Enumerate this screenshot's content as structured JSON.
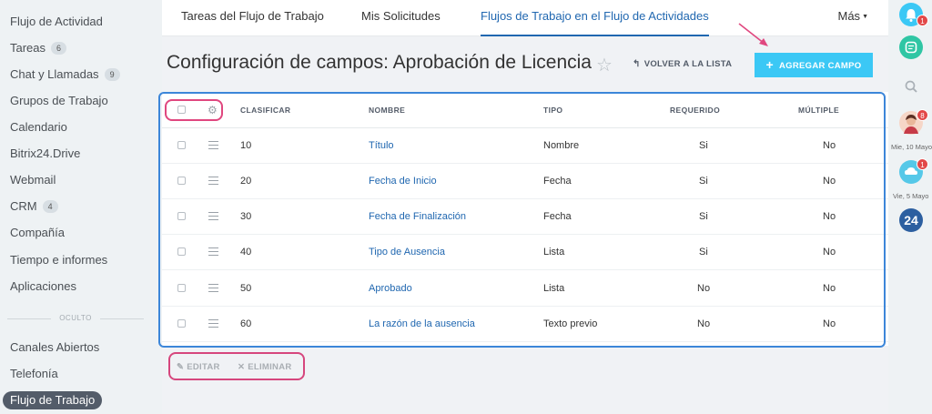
{
  "sidebar": {
    "items": [
      {
        "label": "Flujo de Actividad",
        "count": ""
      },
      {
        "label": "Tareas",
        "count": "6"
      },
      {
        "label": "Chat y Llamadas",
        "count": "9"
      },
      {
        "label": "Grupos de Trabajo",
        "count": ""
      },
      {
        "label": "Calendario",
        "count": ""
      },
      {
        "label": "Bitrix24.Drive",
        "count": ""
      },
      {
        "label": "Webmail",
        "count": ""
      },
      {
        "label": "CRM",
        "count": "4"
      },
      {
        "label": "Compañía",
        "count": ""
      },
      {
        "label": "Tiempo e informes",
        "count": ""
      },
      {
        "label": "Aplicaciones",
        "count": ""
      }
    ],
    "hidden_label": "OCULTO",
    "hidden_items": [
      {
        "label": "Canales Abiertos"
      },
      {
        "label": "Telefonía"
      },
      {
        "label": "Flujo de Trabajo"
      }
    ]
  },
  "topnav": {
    "tabs": [
      {
        "label": "Tareas del Flujo de Trabajo"
      },
      {
        "label": "Mis Solicitudes"
      },
      {
        "label": "Flujos de Trabajo en el Flujo de Actividades"
      }
    ],
    "more_label": "Más"
  },
  "page": {
    "title": "Configuración de campos: Aprobación de Licencia",
    "back_label": "VOLVER A LA LISTA",
    "add_label": "AGREGAR CAMPO"
  },
  "table": {
    "headers": {
      "sort": "CLASIFICAR",
      "name": "NOMBRE",
      "type": "TIPO",
      "required": "REQUERIDO",
      "multiple": "MÚLTIPLE"
    },
    "rows": [
      {
        "sort": "10",
        "name": "Título",
        "type": "Nombre",
        "required": "Si",
        "multiple": "No"
      },
      {
        "sort": "20",
        "name": "Fecha de Inicio",
        "type": "Fecha",
        "required": "Si",
        "multiple": "No"
      },
      {
        "sort": "30",
        "name": "Fecha de Finalización",
        "type": "Fecha",
        "required": "Si",
        "multiple": "No"
      },
      {
        "sort": "40",
        "name": "Tipo de Ausencia",
        "type": "Lista",
        "required": "Si",
        "multiple": "No"
      },
      {
        "sort": "50",
        "name": "Aprobado",
        "type": "Lista",
        "required": "No",
        "multiple": "No"
      },
      {
        "sort": "60",
        "name": "La razón de la ausencia",
        "type": "Texto previo",
        "required": "No",
        "multiple": "No"
      }
    ]
  },
  "actions": {
    "edit_label": "EDITAR",
    "delete_label": "ELIMINAR"
  },
  "rightbar": {
    "notifications_badge": "1",
    "avatar_badge": "8",
    "avatar_date": "Mie, 10 Mayo",
    "cloud_badge": "1",
    "cloud_date": "Vie, 5 Mayo",
    "logo_text": "24"
  },
  "colors": {
    "accent": "#3bc8f5",
    "link": "#2067b0",
    "highlight_pink": "#e0477f",
    "highlight_blue": "#3c86d9"
  }
}
